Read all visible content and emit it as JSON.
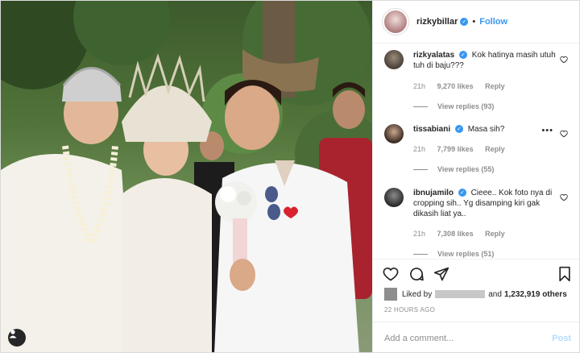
{
  "header": {
    "username": "rizkybillar",
    "separator": "•",
    "follow_label": "Follow"
  },
  "comments": [
    {
      "username": "rizkyalatas",
      "text": "Kok hatinya masih utuh tuh di baju???",
      "time": "21h",
      "likes": "9,270 likes",
      "reply": "Reply",
      "view_replies": "View replies (93)",
      "verified": true
    },
    {
      "username": "tissabiani",
      "text": "Masa sih?",
      "time": "21h",
      "likes": "7,799 likes",
      "reply": "Reply",
      "view_replies": "View replies (55)",
      "verified": true
    },
    {
      "username": "ibnujamilo",
      "text": "Cieee.. Kok foto nya di cropping sih.. Yg disamping kiri gak dikasih liat ya..",
      "time": "21h",
      "likes": "7,308 likes",
      "reply": "Reply",
      "view_replies": "View replies (51)",
      "verified": true
    }
  ],
  "likes": {
    "prefix": "Liked by",
    "and": "and",
    "count": "1,232,919 others"
  },
  "timestamp": "22 HOURS AGO",
  "add_comment": {
    "placeholder": "Add a comment...",
    "post_label": "Post"
  },
  "colors": {
    "accent": "#3897f0",
    "secondary_text": "#8e8e8e",
    "primary_text": "#262626",
    "border": "#efefef"
  },
  "icons": {
    "like": "heart-icon",
    "comment": "comment-icon",
    "share": "share-icon",
    "save": "bookmark-icon",
    "user_tag": "user-icon"
  }
}
